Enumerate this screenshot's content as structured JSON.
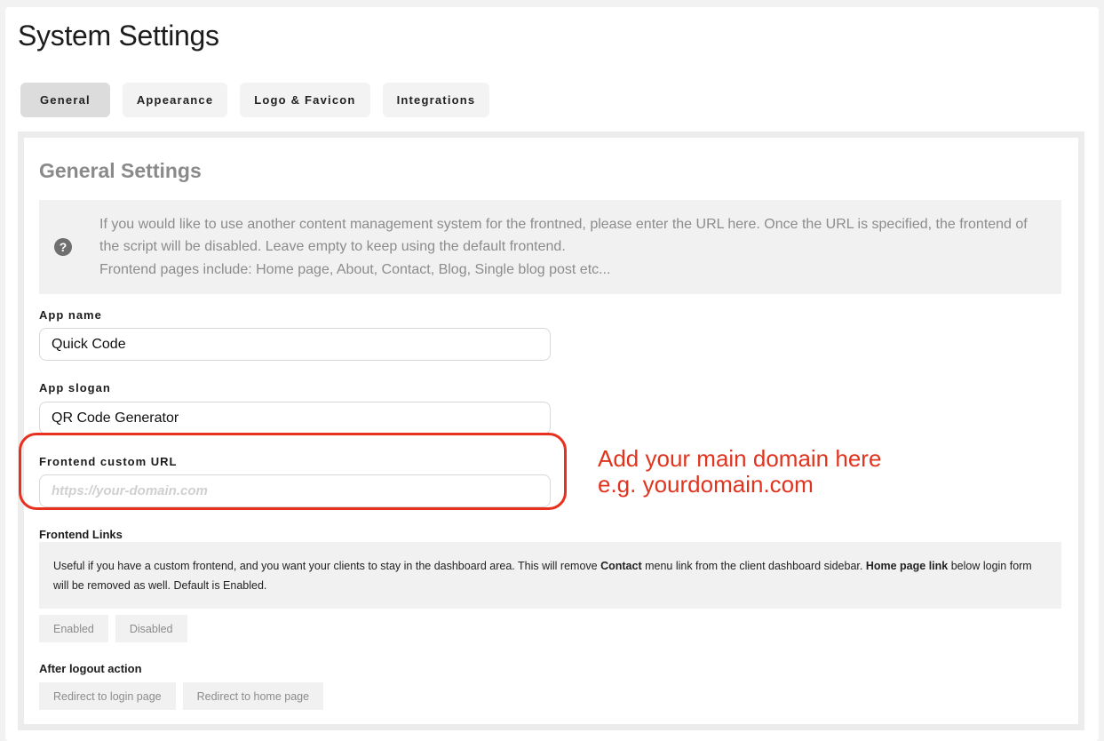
{
  "page": {
    "title": "System Settings"
  },
  "tabs": [
    {
      "label": "General",
      "active": true
    },
    {
      "label": "Appearance",
      "active": false
    },
    {
      "label": "Logo & Favicon",
      "active": false
    },
    {
      "label": "Integrations",
      "active": false
    }
  ],
  "general": {
    "title": "General Settings",
    "info": {
      "icon": "question-circle-icon",
      "line1": "If you would like to use another content management system for the frontned, please enter the URL here. Once the URL is specified, the frontend of the script will be disabled. Leave empty to keep using the default frontend.",
      "line2": "Frontend pages include: Home page, About, Contact, Blog, Single blog post etc..."
    },
    "app_name": {
      "label": "App name",
      "value": "Quick Code"
    },
    "app_slogan": {
      "label": "App slogan",
      "value": "QR Code Generator"
    },
    "frontend_url": {
      "label": "Frontend custom URL",
      "value": "",
      "placeholder": "https://your-domain.com"
    },
    "annotation": {
      "line1": "Add your main domain here",
      "line2": "e.g. yourdomain.com",
      "color": "#e0341f"
    },
    "frontend_links": {
      "label": "Frontend Links",
      "note_part1": "Useful if you have a custom frontend, and you want your clients to stay in the dashboard area. This will remove ",
      "note_bold1": "Contact",
      "note_part2": " menu link from the client dashboard sidebar. ",
      "note_bold2": "Home page link",
      "note_part3": " below login form will be removed as well. Default is Enabled.",
      "options": [
        "Enabled",
        "Disabled"
      ]
    },
    "after_logout": {
      "label": "After logout action",
      "options": [
        "Redirect to login page",
        "Redirect to home page"
      ]
    }
  }
}
